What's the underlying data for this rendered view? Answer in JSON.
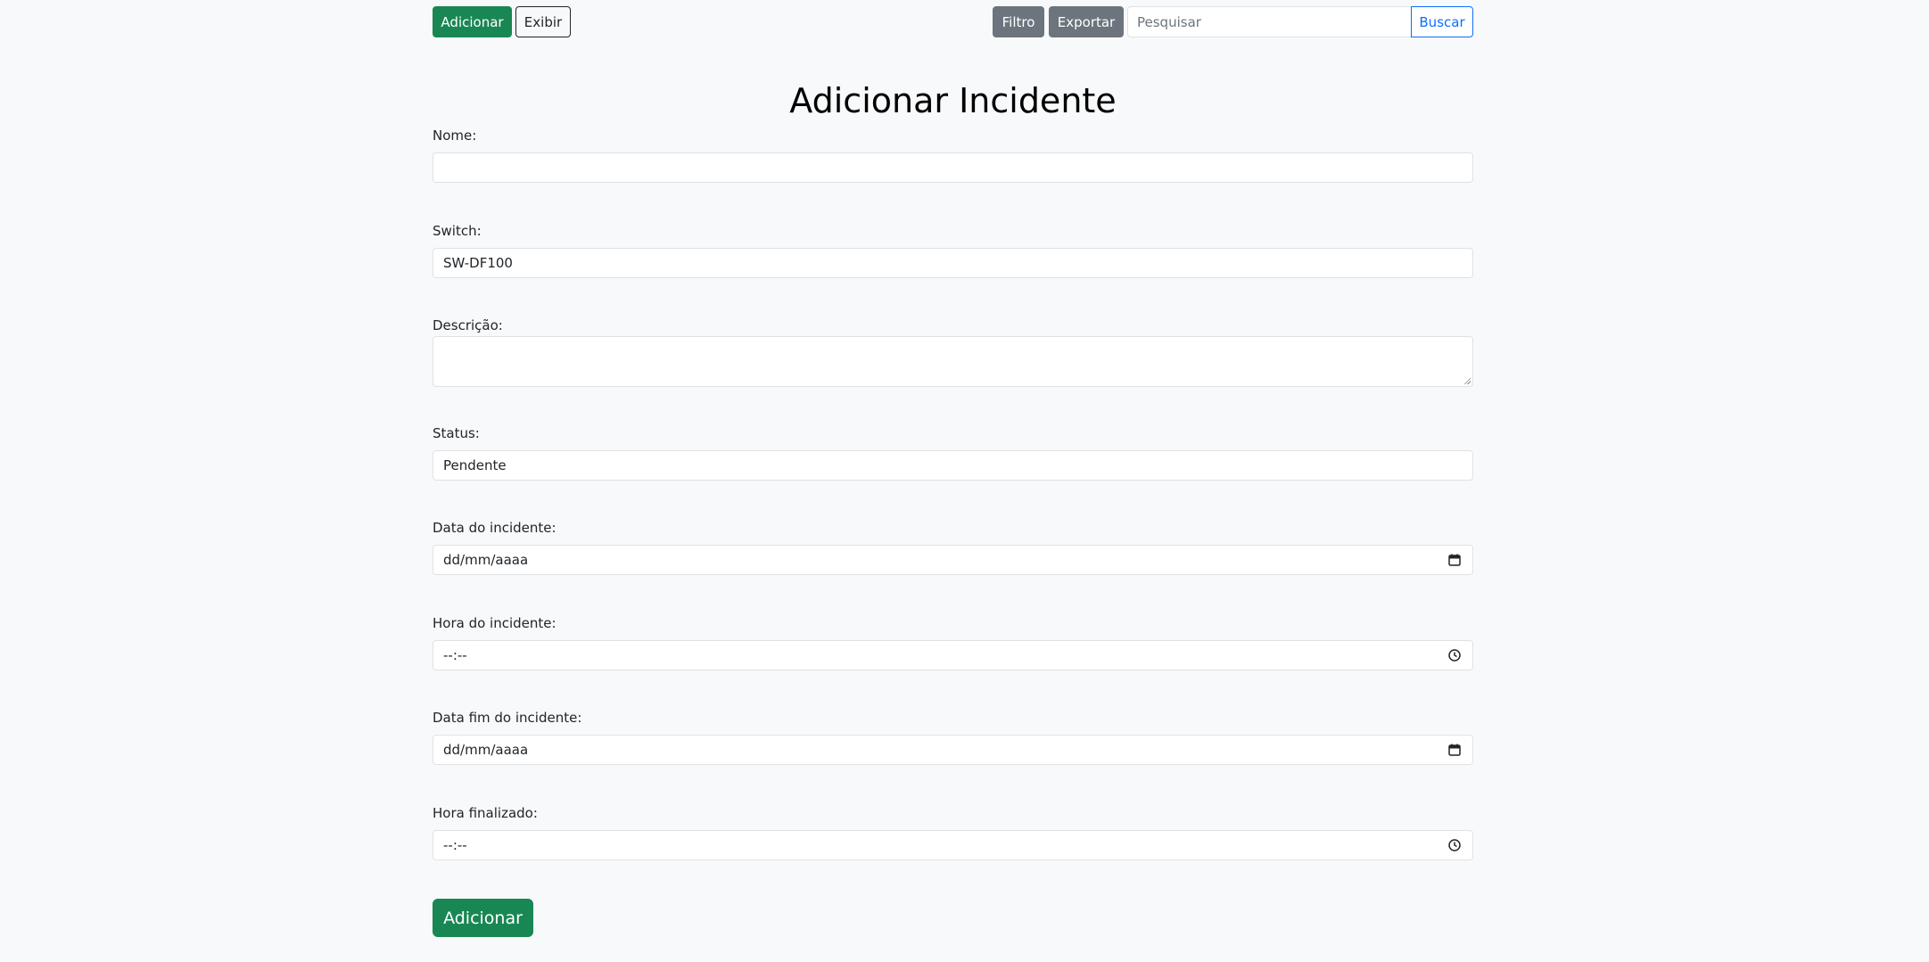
{
  "toolbar": {
    "add_label": "Adicionar",
    "view_label": "Exibir",
    "filter_label": "Filtro",
    "export_label": "Exportar",
    "search_placeholder": "Pesquisar",
    "search_button_label": "Buscar"
  },
  "page": {
    "title": "Adicionar Incidente"
  },
  "form": {
    "name": {
      "label": "Nome:",
      "value": ""
    },
    "switch": {
      "label": "Switch:",
      "value": "SW-DF100"
    },
    "description": {
      "label": "Descrição:",
      "value": ""
    },
    "status": {
      "label": "Status:",
      "value": "Pendente"
    },
    "incident_date": {
      "label": "Data do incidente:",
      "value": "dd/mm/aaaa",
      "icon": "calendar-icon"
    },
    "incident_time": {
      "label": "Hora do incidente:",
      "value": "--:--",
      "icon": "clock-icon"
    },
    "incident_end_date": {
      "label": "Data fim do incidente:",
      "value": "dd/mm/aaaa",
      "icon": "calendar-icon"
    },
    "finished_time": {
      "label": "Hora finalizado:",
      "value": "--:--",
      "icon": "clock-icon"
    },
    "submit_label": "Adicionar"
  },
  "colors": {
    "success": "#198754",
    "secondary": "#6c757d",
    "primary": "#0d6efd",
    "background": "#f8f9fa",
    "border": "#dee2e6"
  }
}
